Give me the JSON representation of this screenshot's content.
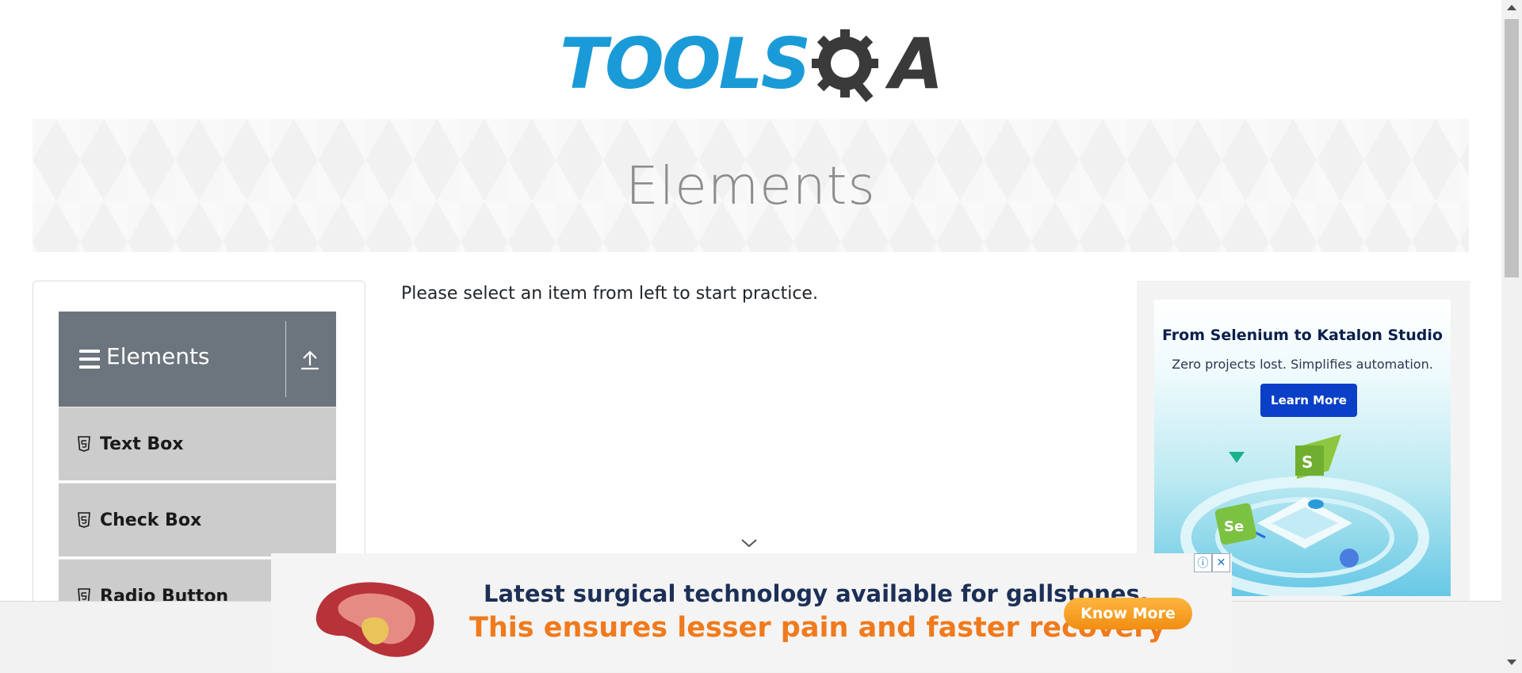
{
  "logo": {
    "text_left": "TOOLS",
    "text_right": "A",
    "icon": "gear-magnifier-icon"
  },
  "banner": {
    "title": "Elements"
  },
  "sidebar": {
    "group": {
      "title": "Elements",
      "menu_icon": "hamburger-icon",
      "toggle_icon": "upload-icon"
    },
    "items": [
      {
        "label": "Text Box",
        "icon": "html5-icon"
      },
      {
        "label": "Check Box",
        "icon": "html5-icon"
      },
      {
        "label": "Radio Button",
        "icon": "html5-icon"
      }
    ]
  },
  "main": {
    "instruction": "Please select an item from left to start practice."
  },
  "right_ad": {
    "headline": "From Selenium to Katalon Studio",
    "subtext": "Zero projects lost. Simplifies automation.",
    "button": "Learn More"
  },
  "bottom_ad": {
    "line1": "Latest surgical technology available for gallstones.",
    "line2": "This ensures lesser pain and faster recovery",
    "button": "Know More",
    "adchoices_icon": "info-icon",
    "close_icon": "close-icon"
  },
  "colors": {
    "brand_blue": "#1a9bd7",
    "header_gray": "#6c757d",
    "item_gray": "#cccccc",
    "ad_orange": "#f07a1c"
  }
}
